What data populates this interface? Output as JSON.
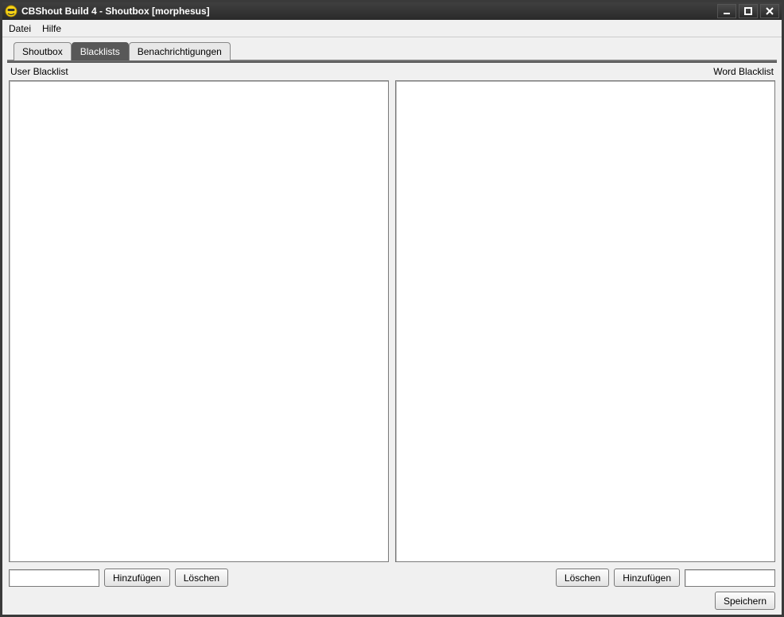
{
  "window": {
    "title": "CBShout Build 4 - Shoutbox [morphesus]"
  },
  "menubar": {
    "file": "Datei",
    "help": "Hilfe"
  },
  "tabs": {
    "shoutbox": "Shoutbox",
    "blacklists": "Blacklists",
    "notifications": "Benachrichtigungen",
    "active": "blacklists"
  },
  "panel": {
    "user_label": "User Blacklist",
    "word_label": "Word Blacklist",
    "user_items": [],
    "word_items": [],
    "user_input": "",
    "word_input": "",
    "btn_add": "Hinzufügen",
    "btn_delete": "Löschen",
    "btn_save": "Speichern"
  }
}
